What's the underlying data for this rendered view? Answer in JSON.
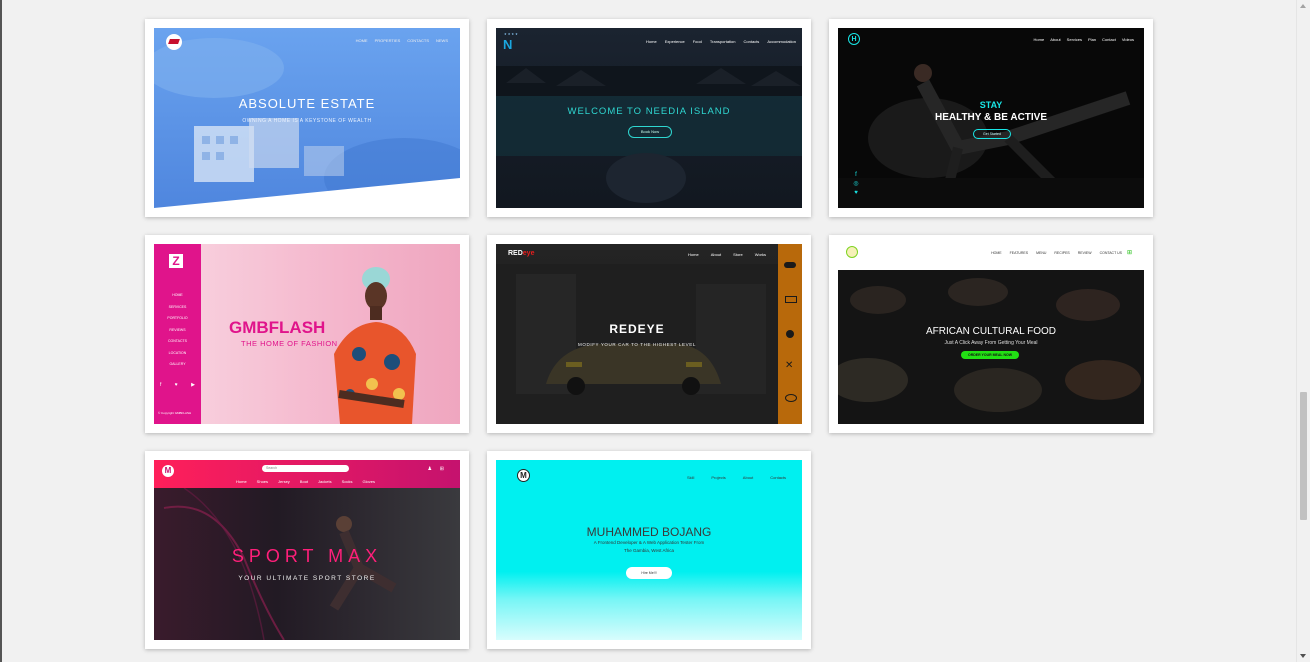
{
  "cards": [
    {
      "brand": "Absolute Estate",
      "nav": [
        "HOME",
        "PROPERTIES",
        "CONTACTS",
        "NEWS"
      ],
      "title": "ABSOLUTE ESTATE",
      "subtitle": "OWNING A HOME IS A KEYSTONE OF WEALTH"
    },
    {
      "nav": [
        "Home",
        "Experience",
        "Food",
        "Transportation",
        "Contacts",
        "Accommodation"
      ],
      "title": "WELCOME TO NEEDIA ISLAND",
      "button": "Book Now"
    },
    {
      "nav": [
        "Home",
        "About",
        "Services",
        "Plan",
        "Contact",
        "Videos"
      ],
      "title_top": "STAY",
      "title": "HEALTHY & BE ACTIVE",
      "button": "Get Started"
    },
    {
      "side_nav": [
        "HOME",
        "SERVICES",
        "PORTFOLIO",
        "REVIEWS",
        "CONTACTS",
        "LOCATION",
        "GALLERY"
      ],
      "title": "GMBFLASH",
      "subtitle": "THE HOME OF FASHION",
      "copyright": "© Copyright GMBFLASH"
    },
    {
      "logo_a": "RED",
      "logo_b": "eye",
      "nav": [
        "Home",
        "About",
        "Store",
        "Works"
      ],
      "title": "REDEYE",
      "subtitle": "MODIFY YOUR CAR TO THE HIGHEST LEVEL"
    },
    {
      "nav": [
        "HOME",
        "FEATURES",
        "MENU",
        "RECIPES",
        "REVIEW",
        "CONTACT US"
      ],
      "title": "AFRICAN CULTURAL FOOD",
      "subtitle": "Just A Click Away From Getting Your Meal",
      "button": "ORDER YOUR MEAL NOW"
    },
    {
      "search_placeholder": "Search",
      "nav": [
        "Home",
        "Shoes",
        "Jersey",
        "Boot",
        "Jackets",
        "Socks",
        "Gloves"
      ],
      "title": "SPORT MAX",
      "subtitle": "YOUR ULTIMATE SPORT STORE"
    },
    {
      "nav": [
        "Skill",
        "Projects",
        "About",
        "Contacts"
      ],
      "title": "MUHAMMED BOJANG",
      "subtitle_1": "A Frontend Developer & A Web Application Tester From",
      "subtitle_2": "The Gambia, West Africa",
      "button": "Hire Me!!!"
    }
  ],
  "colors": {
    "page_bg": "#f1f1f1",
    "estate_blue": "#5b95e6",
    "needia_teal": "#2fd6d0",
    "stay_cyan": "#19e6e6",
    "gmb_magenta": "#e0148b",
    "gmb_pink": "#f4b6cc",
    "redeye_orange": "#b8690b",
    "food_green": "#22e014",
    "sport_pink": "#ff1f7a",
    "bojang_cyan": "#00f0f0"
  }
}
